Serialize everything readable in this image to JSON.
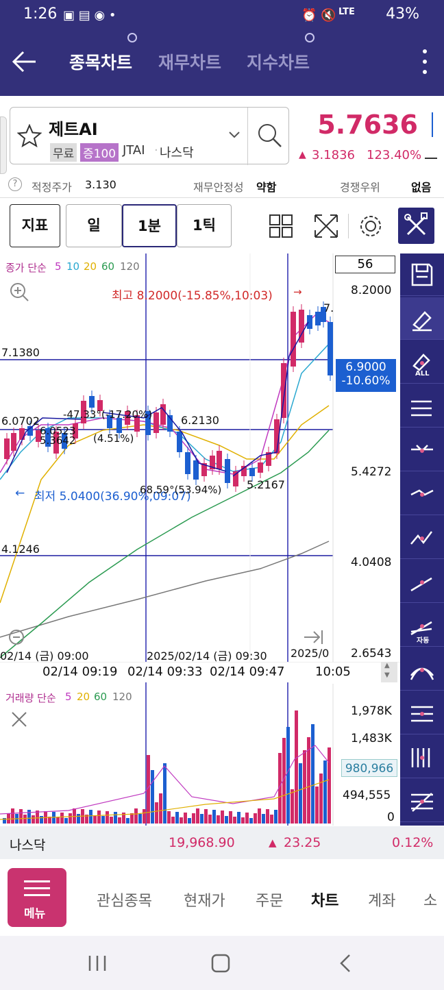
{
  "status": {
    "time": "1:26",
    "battery": "43%",
    "network": "LTE"
  },
  "header": {
    "tabs": [
      {
        "label": "종목차트"
      },
      {
        "label": "재무차트"
      },
      {
        "label": "지수차트"
      }
    ]
  },
  "stock": {
    "name": "제트AI",
    "badges": {
      "free": "무료",
      "margin": "증100"
    },
    "ticker": "JTAI",
    "market": "나스닥",
    "price": "5.7636",
    "change": "3.1836",
    "change_pct": "123.40%"
  },
  "info_row": {
    "fair_price_label": "적정주가",
    "fair_price_value": "3.130",
    "stability_label": "재무안정성",
    "stability_value": "약함",
    "competition_label": "경쟁우위",
    "competition_value": "없음"
  },
  "toolbar": {
    "indicator": "지표",
    "periods": [
      "일",
      "1분",
      "1틱"
    ]
  },
  "chart_data": [
    {
      "type": "candlestick",
      "title": "종가 단순 5 10 20 60 120",
      "legend": {
        "label": "종가 단순",
        "periods": [
          "5",
          "10",
          "20",
          "60",
          "120"
        ]
      },
      "count_box": "56",
      "y_ticks": [
        "8.2000",
        "5.4272",
        "4.0408",
        "2.6543"
      ],
      "current_price_tag": {
        "price": "6.9000",
        "pct": "-10.60%"
      },
      "high_annotation": "최고 8.2000(-15.85%,10:03)",
      "low_annotation": "최저 5.0400(36.90%,09:07)",
      "horizontal_levels": [
        "7.1380",
        "6.0702",
        "4.1246"
      ],
      "line_labels": [
        "6.0523",
        "5.3642",
        "-47.33°(-17.20%)",
        "(4.51%)",
        "6.2130",
        "68.59°(53.94%)",
        "5.2167",
        "7."
      ],
      "x_time_labels": [
        "02/14 (금) 09:00",
        "2025/02/14 (금) 09:30",
        "2025/0"
      ],
      "crosshair_times": [
        "02/14 09:19",
        "02/14 09:33",
        "02/14 09:47",
        "10:05"
      ]
    },
    {
      "type": "bar",
      "title": "거래량 단순 5 20 60 120",
      "legend": {
        "label": "거래량 단순",
        "periods": [
          "5",
          "20",
          "60",
          "120"
        ]
      },
      "y_ticks": [
        "1,978K",
        "1,483K",
        "494,555",
        "0"
      ],
      "current_volume_tag": "980,966"
    }
  ],
  "bottom_ticker": {
    "market": "나스닥",
    "value": "19,968.90",
    "change": "23.25",
    "pct": "0.12%"
  },
  "bottom_nav": {
    "menu_label": "메뉴",
    "items": [
      "관심종목",
      "현재가",
      "주문",
      "차트",
      "계좌",
      "소"
    ]
  },
  "sidebar": {
    "icons": [
      "save-icon",
      "eraser-icon",
      "eraser-all-icon",
      "hcl-icon",
      "trend-icon",
      "angle-icon",
      "zigzag-icon",
      "line-icon",
      "auto-icon",
      "fan-icon",
      "arc-icon",
      "fib-icon",
      "gann-icon"
    ],
    "labels": {
      "all": "ALL",
      "auto": "자동"
    }
  },
  "colors": {
    "header": "#33307a",
    "up": "#d12a67",
    "down": "#1c5fd0",
    "accent": "#2a2877"
  }
}
